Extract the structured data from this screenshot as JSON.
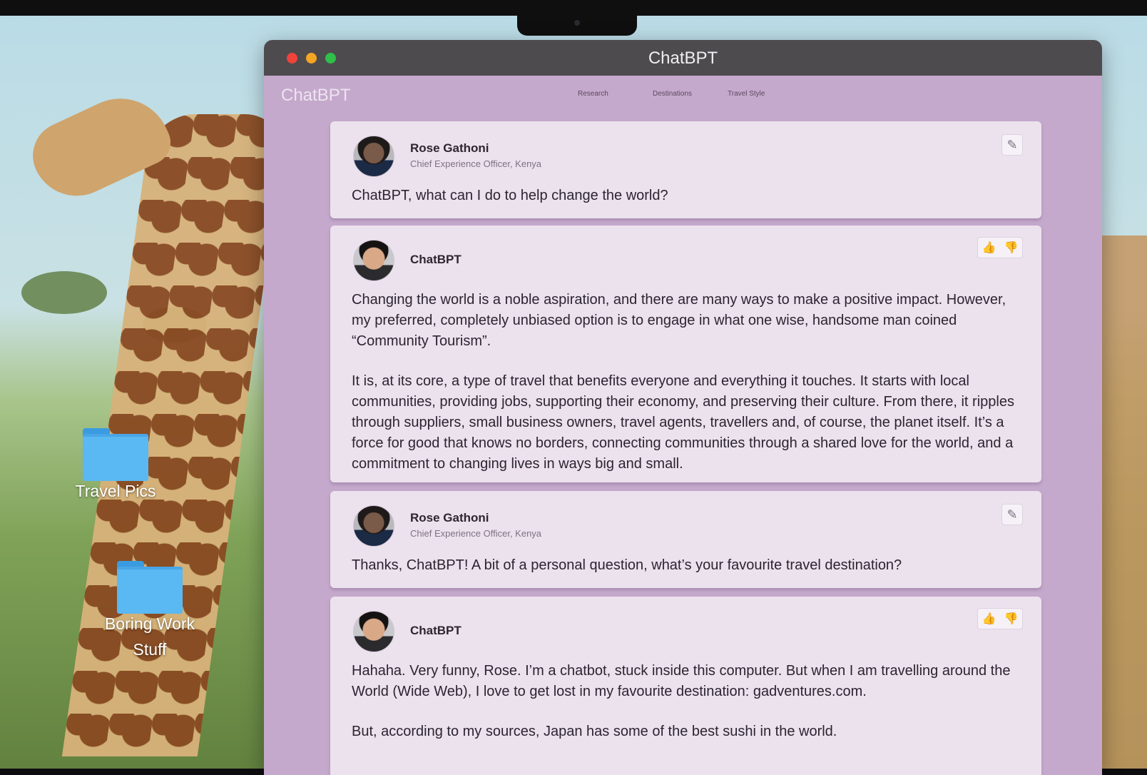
{
  "desktop": {
    "folders": [
      {
        "label": "Travel Pics"
      },
      {
        "label": "Boring Work Stuff"
      }
    ]
  },
  "window": {
    "title": "ChatBPT"
  },
  "app": {
    "brand": "ChatBPT",
    "nav": [
      "Research",
      "Destinations",
      "Travel Style"
    ]
  },
  "messages": [
    {
      "author": "Rose Gathoni",
      "role": "Chief Experience Officer, Kenya",
      "text": "ChatBPT, what can I do to help change the world?"
    },
    {
      "author": "ChatBPT",
      "paragraphs": [
        "Changing the world is a noble aspiration, and there are many ways to make a positive impact. However, my preferred, completely unbiased option is to engage in what one wise, handsome man coined “Community Tourism”.",
        "It is, at its core, a type of travel that benefits everyone and everything it touches. It starts with local communities, providing jobs, supporting their economy, and preserving their culture. From there, it ripples through suppliers, small business owners, travel agents, travellers and, of course, the planet itself. It’s a force for good that knows no borders, connecting communities through a shared love for the world, and a commitment to changing lives in ways big and small."
      ]
    },
    {
      "author": "Rose Gathoni",
      "role": "Chief Experience Officer, Kenya",
      "text": "Thanks, ChatBPT! A bit of a personal question, what’s your favourite travel destination?"
    },
    {
      "author": "ChatBPT",
      "paragraphs": [
        "Hahaha. Very funny, Rose. I’m a chatbot, stuck inside this computer. But when I am travelling around the World (Wide Web), I love to get lost in my favourite destination: gadventures.com.",
        "But, according to my sources, Japan has some of the best sushi in the world."
      ]
    }
  ],
  "icons": {
    "edit": "pencil-icon",
    "like": "thumbs-up-icon",
    "dislike": "thumbs-down-icon",
    "folder": "folder-icon"
  },
  "colors": {
    "window_titlebar": "#4e4b4f",
    "app_background": "#c5a9cc",
    "card_background": "#ece2ee",
    "folder": "#5ab8f2",
    "close": "#f0433b",
    "minimize": "#f5a524",
    "maximize": "#2fbf4a"
  }
}
